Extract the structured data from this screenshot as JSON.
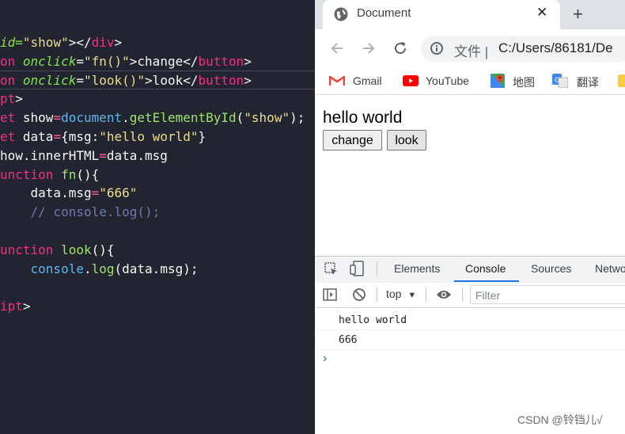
{
  "editor": {
    "lines": [
      [
        [
          "id=",
          "a"
        ],
        [
          "\"show\"",
          "s"
        ],
        [
          "></",
          "p"
        ],
        [
          "div",
          "k"
        ],
        [
          ">",
          "p"
        ]
      ],
      [
        [
          "on ",
          "k"
        ],
        [
          "onclick",
          "a"
        ],
        [
          "=",
          "p"
        ],
        [
          "\"fn()\"",
          "s"
        ],
        [
          ">change</",
          "p"
        ],
        [
          "button",
          "k"
        ],
        [
          ">",
          "p"
        ]
      ],
      [
        [
          "on ",
          "k"
        ],
        [
          "onclick",
          "a"
        ],
        [
          "=",
          "p"
        ],
        [
          "\"look()\"",
          "s"
        ],
        [
          ">look</",
          "p"
        ],
        [
          "button",
          "k"
        ],
        [
          ">",
          "p"
        ]
      ],
      [
        [
          "pt",
          "k"
        ],
        [
          ">",
          "p"
        ]
      ],
      [
        [
          "et ",
          "k"
        ],
        [
          "show",
          "p"
        ],
        [
          "=",
          "o"
        ],
        [
          "document",
          "b"
        ],
        [
          ".",
          "p"
        ],
        [
          "getElementById",
          "f"
        ],
        [
          "(",
          "p"
        ],
        [
          "\"show\"",
          "s"
        ],
        [
          ");",
          "p"
        ]
      ],
      [
        [
          "et ",
          "k"
        ],
        [
          "data",
          "p"
        ],
        [
          "=",
          "o"
        ],
        [
          "{msg:",
          "p"
        ],
        [
          "\"hello world\"",
          "s"
        ],
        [
          "}",
          "p"
        ]
      ],
      [
        [
          "how.innerHTML",
          "p"
        ],
        [
          "=",
          "o"
        ],
        [
          "data.msg",
          "p"
        ]
      ],
      [
        [
          "unction ",
          "k"
        ],
        [
          "fn",
          "f"
        ],
        [
          "(){",
          "p"
        ]
      ],
      [
        [
          "    data.msg",
          "p"
        ],
        [
          "=",
          "o"
        ],
        [
          "\"666\"",
          "s"
        ]
      ],
      [
        [
          "    // console.log();",
          "c"
        ]
      ],
      [
        [
          "",
          "p"
        ]
      ],
      [
        [
          "unction ",
          "k"
        ],
        [
          "look",
          "f"
        ],
        [
          "(){",
          "p"
        ]
      ],
      [
        [
          "    ",
          "p"
        ],
        [
          "console",
          "b"
        ],
        [
          ".",
          "p"
        ],
        [
          "log",
          "f"
        ],
        [
          "(data.msg);",
          "p"
        ]
      ],
      [
        [
          "",
          "p"
        ]
      ],
      [
        [
          "ipt",
          "k"
        ],
        [
          ">",
          "p"
        ]
      ]
    ]
  },
  "browser": {
    "tab_title": "Document",
    "close_glyph": "✕",
    "new_tab_glyph": "+",
    "url_scheme": "文件 |",
    "url_path": "C:/Users/86181/De",
    "bookmarks": [
      "Gmail",
      "YouTube",
      "地图",
      "翻译"
    ],
    "page": {
      "show_text": "hello world",
      "change_label": "change",
      "look_label": "look"
    },
    "devtools": {
      "tabs": [
        "Elements",
        "Console",
        "Sources",
        "Netwo"
      ],
      "active_tab": "Console",
      "context": "top",
      "filter_placeholder": "Filter",
      "logs": [
        "hello world",
        "666"
      ],
      "prompt": "›"
    }
  },
  "watermark": "CSDN @铃铛儿√",
  "colors": {
    "editor_bg": "#222430",
    "keyword": "#f72d87",
    "attribute": "#85e34a",
    "string": "#eadd8f",
    "function": "#9ee36d",
    "devtools_accent": "#1a73e8"
  }
}
